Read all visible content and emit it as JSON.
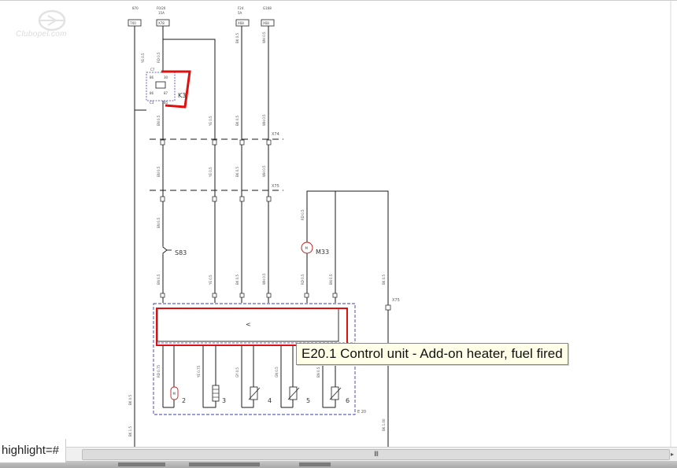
{
  "watermark": {
    "text": "Clubopel.com"
  },
  "diagram": {
    "top_terminals": [
      {
        "name": "870",
        "sub": "",
        "code": "7X0"
      },
      {
        "name": "F0/20",
        "sub": "15A",
        "code": "X78"
      },
      {
        "name": "F24",
        "sub": "5A",
        "code": "X68"
      },
      {
        "name": "G168",
        "sub": "",
        "code": "X68"
      }
    ],
    "relay": {
      "label": "K3",
      "pins": [
        "C7",
        "86",
        "86",
        "30",
        "87",
        "85",
        "C3"
      ]
    },
    "connectors": [
      "X74",
      "X75",
      "X75"
    ],
    "switch": {
      "label": "S83"
    },
    "motor": {
      "label": "M33",
      "symbol": "M"
    },
    "control_unit": {
      "label": "E 20",
      "symbol": "<"
    },
    "components": [
      {
        "label": "2",
        "symbol": "M"
      },
      {
        "label": "3",
        "symbol": ""
      },
      {
        "label": "4",
        "symbol": ""
      },
      {
        "label": "5",
        "symbol": ""
      },
      {
        "label": "6",
        "symbol": ""
      }
    ]
  },
  "tooltip": {
    "text": "E20.1 Control unit - Add-on heater, fuel fired"
  },
  "status_bar": {
    "text": "highlight=#"
  },
  "scrollbar": {
    "grip": "III"
  },
  "colors": {
    "highlight": "#e01010",
    "dashed_box": "#3b3bb0",
    "wire": "#1a1a1a",
    "tooltip_bg": "#ffffe8"
  }
}
